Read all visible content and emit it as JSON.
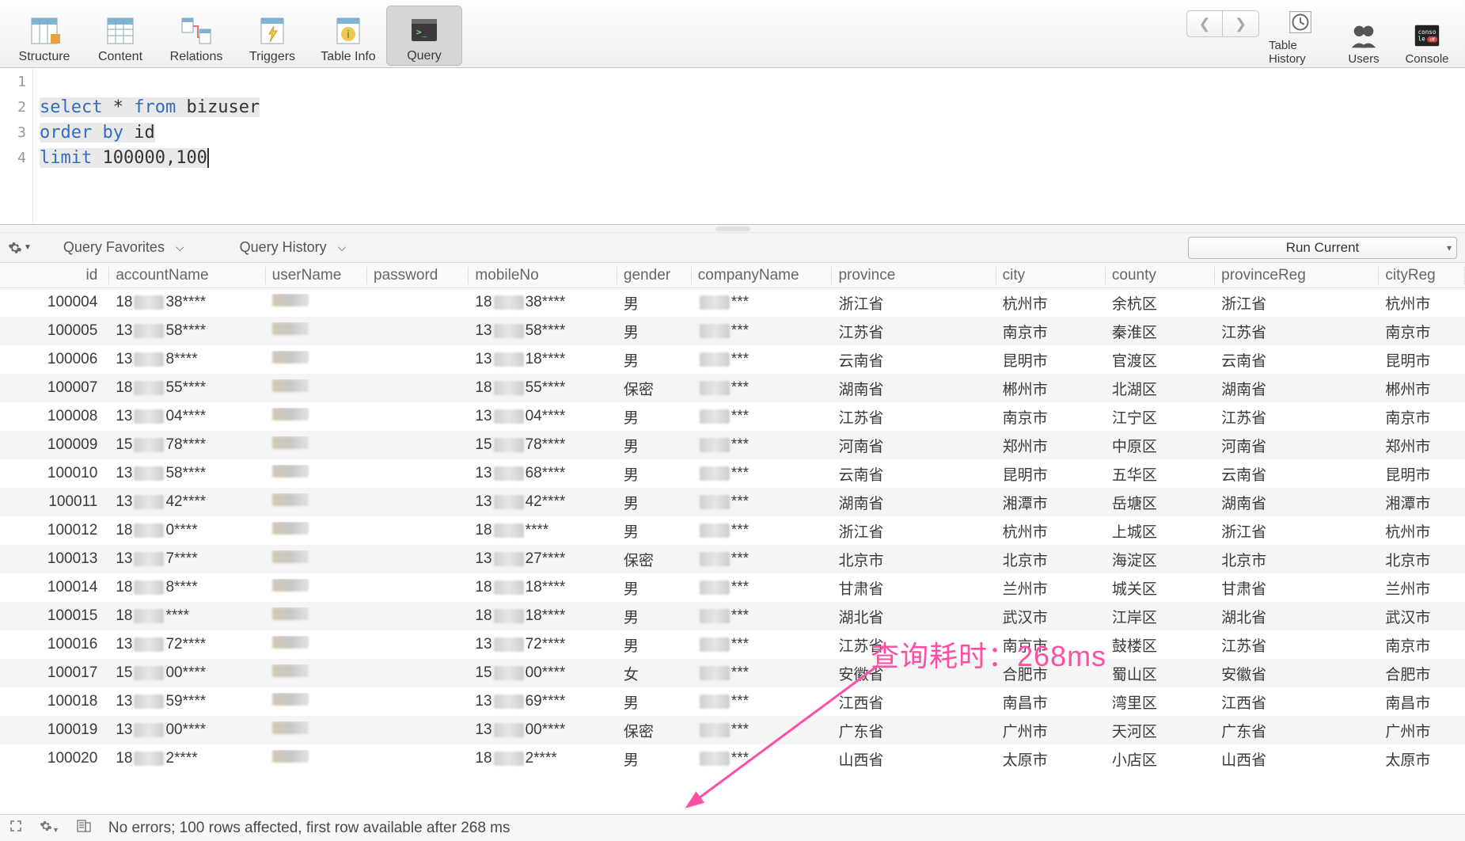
{
  "toolbar": {
    "left": [
      {
        "name": "structure",
        "label": "Structure"
      },
      {
        "name": "content",
        "label": "Content"
      },
      {
        "name": "relations",
        "label": "Relations"
      },
      {
        "name": "triggers",
        "label": "Triggers"
      },
      {
        "name": "tableinfo",
        "label": "Table Info"
      },
      {
        "name": "query",
        "label": "Query",
        "active": true
      }
    ],
    "right": [
      {
        "name": "tablehistory",
        "label": "Table History"
      },
      {
        "name": "users",
        "label": "Users"
      },
      {
        "name": "console",
        "label": "Console"
      }
    ]
  },
  "editor": {
    "lines": [
      "",
      "select * from bizuser",
      "order by id",
      "limit 100000,100"
    ],
    "tokens": {
      "l2_select": "select",
      "l2_star": " * ",
      "l2_from": "from",
      "l2_table": " bizuser",
      "l3_order": "order",
      "l3_by": " by",
      "l3_id": " id",
      "l4_limit": "limit",
      "l4_args": " 100000,100"
    }
  },
  "midbar": {
    "favorites": "Query Favorites",
    "history": "Query History",
    "run": "Run Current"
  },
  "columns": [
    {
      "key": "id",
      "label": "id",
      "cls": "c-id"
    },
    {
      "key": "accountName",
      "label": "accountName",
      "cls": "c-account"
    },
    {
      "key": "userName",
      "label": "userName",
      "cls": "c-user"
    },
    {
      "key": "password",
      "label": "password",
      "cls": "c-pass"
    },
    {
      "key": "mobileNo",
      "label": "mobileNo",
      "cls": "c-mobile"
    },
    {
      "key": "gender",
      "label": "gender",
      "cls": "c-gender"
    },
    {
      "key": "companyName",
      "label": "companyName",
      "cls": "c-company"
    },
    {
      "key": "province",
      "label": "province",
      "cls": "c-province"
    },
    {
      "key": "city",
      "label": "city",
      "cls": "c-city"
    },
    {
      "key": "county",
      "label": "county",
      "cls": "c-county"
    },
    {
      "key": "provinceReg",
      "label": "provinceReg",
      "cls": "c-provreg"
    },
    {
      "key": "cityReg",
      "label": "cityReg",
      "cls": "c-cityreg"
    }
  ],
  "rows": [
    {
      "id": "100004",
      "acc_a": "18",
      "acc_b": "38****",
      "mob_a": "18",
      "mob_b": "38****",
      "gender": "男",
      "province": "浙江省",
      "city": "杭州市",
      "county": "余杭区",
      "provreg": "浙江省",
      "cityreg": "杭州市"
    },
    {
      "id": "100005",
      "acc_a": "13",
      "acc_b": "58****",
      "mob_a": "13",
      "mob_b": "58****",
      "gender": "男",
      "province": "江苏省",
      "city": "南京市",
      "county": "秦淮区",
      "provreg": "江苏省",
      "cityreg": "南京市"
    },
    {
      "id": "100006",
      "acc_a": "13",
      "acc_b": "8****",
      "mob_a": "13",
      "mob_b": "18****",
      "gender": "男",
      "province": "云南省",
      "city": "昆明市",
      "county": "官渡区",
      "provreg": "云南省",
      "cityreg": "昆明市"
    },
    {
      "id": "100007",
      "acc_a": "18",
      "acc_b": "55****",
      "mob_a": "18",
      "mob_b": "55****",
      "gender": "保密",
      "province": "湖南省",
      "city": "郴州市",
      "county": "北湖区",
      "provreg": "湖南省",
      "cityreg": "郴州市"
    },
    {
      "id": "100008",
      "acc_a": "13",
      "acc_b": "04****",
      "mob_a": "13",
      "mob_b": "04****",
      "gender": "男",
      "province": "江苏省",
      "city": "南京市",
      "county": "江宁区",
      "provreg": "江苏省",
      "cityreg": "南京市"
    },
    {
      "id": "100009",
      "acc_a": "15",
      "acc_b": "78****",
      "mob_a": "15",
      "mob_b": "78****",
      "gender": "男",
      "province": "河南省",
      "city": "郑州市",
      "county": "中原区",
      "provreg": "河南省",
      "cityreg": "郑州市"
    },
    {
      "id": "100010",
      "acc_a": "13",
      "acc_b": "58****",
      "mob_a": "13",
      "mob_b": "68****",
      "gender": "男",
      "province": "云南省",
      "city": "昆明市",
      "county": "五华区",
      "provreg": "云南省",
      "cityreg": "昆明市"
    },
    {
      "id": "100011",
      "acc_a": "13",
      "acc_b": "42****",
      "mob_a": "13",
      "mob_b": "42****",
      "gender": "男",
      "province": "湖南省",
      "city": "湘潭市",
      "county": "岳塘区",
      "provreg": "湖南省",
      "cityreg": "湘潭市"
    },
    {
      "id": "100012",
      "acc_a": "18",
      "acc_b": "0****",
      "mob_a": "18",
      "mob_b": "****",
      "gender": "男",
      "province": "浙江省",
      "city": "杭州市",
      "county": "上城区",
      "provreg": "浙江省",
      "cityreg": "杭州市"
    },
    {
      "id": "100013",
      "acc_a": "13",
      "acc_b": "7****",
      "mob_a": "13",
      "mob_b": "27****",
      "gender": "保密",
      "province": "北京市",
      "city": "北京市",
      "county": "海淀区",
      "provreg": "北京市",
      "cityreg": "北京市"
    },
    {
      "id": "100014",
      "acc_a": "18",
      "acc_b": "8****",
      "mob_a": "18",
      "mob_b": "18****",
      "gender": "男",
      "province": "甘肃省",
      "city": "兰州市",
      "county": "城关区",
      "provreg": "甘肃省",
      "cityreg": "兰州市"
    },
    {
      "id": "100015",
      "acc_a": "18",
      "acc_b": "****",
      "mob_a": "18",
      "mob_b": "18****",
      "gender": "男",
      "province": "湖北省",
      "city": "武汉市",
      "county": "江岸区",
      "provreg": "湖北省",
      "cityreg": "武汉市"
    },
    {
      "id": "100016",
      "acc_a": "13",
      "acc_b": "72****",
      "mob_a": "13",
      "mob_b": "72****",
      "gender": "男",
      "province": "江苏省",
      "city": "南京市",
      "county": "鼓楼区",
      "provreg": "江苏省",
      "cityreg": "南京市"
    },
    {
      "id": "100017",
      "acc_a": "15",
      "acc_b": "00****",
      "mob_a": "15",
      "mob_b": "00****",
      "gender": "女",
      "province": "安徽省",
      "city": "合肥市",
      "county": "蜀山区",
      "provreg": "安徽省",
      "cityreg": "合肥市"
    },
    {
      "id": "100018",
      "acc_a": "13",
      "acc_b": "59****",
      "mob_a": "13",
      "mob_b": "69****",
      "gender": "男",
      "province": "江西省",
      "city": "南昌市",
      "county": "湾里区",
      "provreg": "江西省",
      "cityreg": "南昌市"
    },
    {
      "id": "100019",
      "acc_a": "13",
      "acc_b": "00****",
      "mob_a": "13",
      "mob_b": "00****",
      "gender": "保密",
      "province": "广东省",
      "city": "广州市",
      "county": "天河区",
      "provreg": "广东省",
      "cityreg": "广州市"
    },
    {
      "id": "100020",
      "acc_a": "18",
      "acc_b": "2****",
      "mob_a": "18",
      "mob_b": "2****",
      "gender": "男",
      "province": "山西省",
      "city": "太原市",
      "county": "小店区",
      "provreg": "山西省",
      "cityreg": "太原市"
    }
  ],
  "status": {
    "message": "No errors; 100 rows affected, first row available after 268 ms"
  },
  "annotation": {
    "text": "查询耗时：268ms"
  }
}
